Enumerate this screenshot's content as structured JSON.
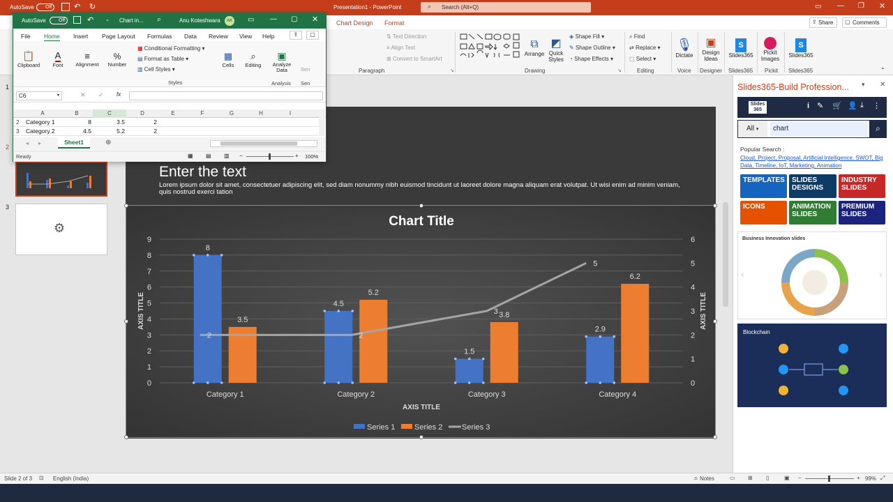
{
  "app": {
    "autosave_label": "AutoSave",
    "autosave_state": "Off",
    "title": "Presentation1 - PowerPoint",
    "search_placeholder": "Search (Alt+Q)",
    "share_label": "Share",
    "comments_label": "Comments"
  },
  "ribbon": {
    "tabs": [
      "Chart Design",
      "Format"
    ],
    "paragraph": {
      "text_direction": "Text Direction",
      "align_text": "Align Text",
      "convert_smartart": "Convert to SmartArt",
      "label": "Paragraph"
    },
    "drawing": {
      "arrange": "Arrange",
      "quick_styles": "Quick Styles",
      "shape_fill": "Shape Fill",
      "shape_outline": "Shape Outline",
      "shape_effects": "Shape Effects",
      "label": "Drawing"
    },
    "editing": {
      "find": "Find",
      "replace": "Replace",
      "select": "Select",
      "label": "Editing"
    },
    "voice": {
      "dictate": "Dictate",
      "label": "Voice"
    },
    "designer": {
      "design_ideas": "Design Ideas",
      "label": "Designer"
    },
    "slides365": {
      "button": "Slides365",
      "label": "Slides365"
    },
    "pickit": {
      "button": "Pickit Images",
      "label": "Pickit"
    },
    "slides365b": {
      "button": "Slides365",
      "label": "Slides365"
    }
  },
  "excel": {
    "autosave_label": "AutoSave",
    "autosave_state": "Off",
    "title": "Chart in...",
    "user": "Anu Koteshwara",
    "user_initials": "AK",
    "tabs": [
      "File",
      "Home",
      "Insert",
      "Page Layout",
      "Formulas",
      "Data",
      "Review",
      "View",
      "Help"
    ],
    "groups": {
      "clipboard": "Clipboard",
      "font": "Font",
      "alignment": "Alignment",
      "number": "Number",
      "conditional_formatting": "Conditional Formatting",
      "format_as_table": "Format as Table",
      "cell_styles": "Cell Styles",
      "styles": "Styles",
      "cells": "Cells",
      "editing": "Editing",
      "analyze_data": "Analyze Data",
      "analysis": "Analysis",
      "sensitivity": "Sen"
    },
    "name_box": "C6",
    "columns": [
      "A",
      "B",
      "C",
      "D",
      "E",
      "F",
      "G",
      "H",
      "I"
    ],
    "rows": [
      {
        "num": "2",
        "a": "Category 1",
        "b": "8",
        "c": "3.5",
        "d": "2"
      },
      {
        "num": "3",
        "a": "Category 2",
        "b": "4.5",
        "c": "5.2",
        "d": "2"
      }
    ],
    "sheet_tab": "Sheet1",
    "status": "Ready",
    "zoom": "100%"
  },
  "slides": {
    "numbers": [
      "1",
      "2",
      "3"
    ]
  },
  "slide": {
    "heading": "Enter the text",
    "body": "Lorem ipsum dolor sit amet, consectetuer adipiscing elit, sed diam nonummy nibh euismod tincidunt ut laoreet dolore magna aliquam erat volutpat. Ut wisi enim ad minim veniam, quis nostrud exerci tation"
  },
  "chart_data": {
    "type": "bar",
    "title": "Chart Title",
    "xlabel": "AXIS TITLE",
    "ylabel": "AXIS TITLE",
    "y2label": "AXIS TITLE",
    "categories": [
      "Category 1",
      "Category 2",
      "Category 3",
      "Category 4"
    ],
    "ylim": [
      0,
      9
    ],
    "y_ticks": [
      "0",
      "1",
      "2",
      "3",
      "4",
      "5",
      "6",
      "7",
      "8",
      "9"
    ],
    "y2lim": [
      0,
      6
    ],
    "y2_ticks": [
      "0",
      "1",
      "2",
      "3",
      "4",
      "5",
      "6"
    ],
    "series": [
      {
        "name": "Series 1",
        "type": "bar",
        "values": [
          8,
          4.5,
          1.5,
          2.9
        ],
        "labels": [
          "8",
          "4.5",
          "1.5",
          "2.9"
        ],
        "color": "#4472c4"
      },
      {
        "name": "Series 2",
        "type": "bar",
        "values": [
          3.5,
          5.2,
          3.8,
          6.2
        ],
        "labels": [
          "3.5",
          "5.2",
          "3.8",
          "6.2"
        ],
        "color": "#ed7d31"
      },
      {
        "name": "Series 3",
        "type": "line",
        "axis": "secondary",
        "values": [
          2,
          2,
          3,
          5
        ],
        "labels": [
          "2",
          "2",
          "3",
          "5"
        ],
        "color": "#a5a5a5"
      }
    ],
    "legend": "bottom",
    "grid": true
  },
  "addin": {
    "title": "Slides365-Build Profession...",
    "logo": "Slides 365",
    "filter": "All",
    "query": "chart",
    "popular_label": "Popular Search :",
    "popular_links": "Cloud, Project, Proposal, Artificial Intelligence, SWOT, Big Data, Timeline, IoT, Marketing, Animation",
    "tiles": [
      "TEMPLATES",
      "SLIDES DESIGNS",
      "INDUSTRY SLIDES",
      "ICONS",
      "ANIMATION SLIDES",
      "PREMIUM SLIDES"
    ],
    "preview1_title": "Business Innovation slides",
    "preview2_title": "Blockchain"
  },
  "status": {
    "slide_info": "Slide 2 of 3",
    "language": "English (India)",
    "notes": "Notes",
    "zoom": "99%"
  }
}
